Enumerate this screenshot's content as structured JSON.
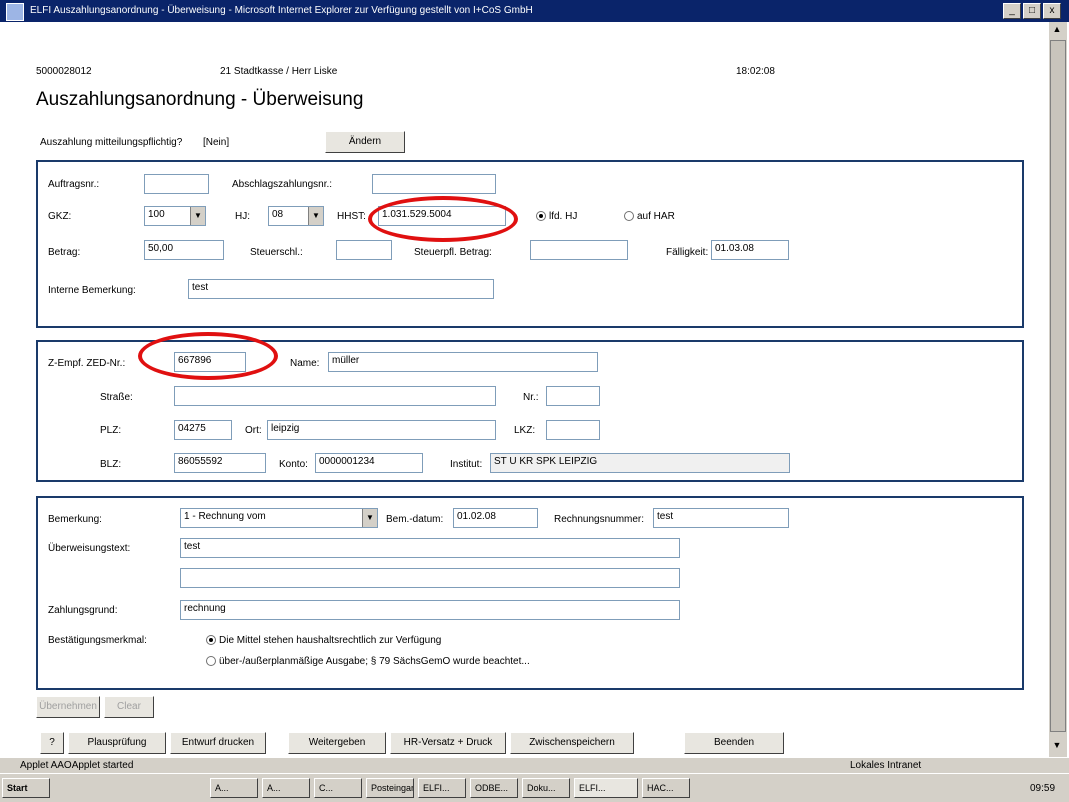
{
  "window": {
    "title": "ELFI Auszahlungsanordnung - Überweisung - Microsoft Internet Explorer zur Verfügung gestellt von I+CoS GmbH",
    "min": "_",
    "max": "□",
    "close": "x"
  },
  "header": {
    "id": "5000028012",
    "office": "21 Stadtkasse / Herr Liske",
    "time": "18:02:08",
    "title": "Auszahlungsanordnung - Überweisung"
  },
  "mitteilung": {
    "question": "Auszahlung mitteilungspflichtig?",
    "value": "[Nein]",
    "change_button": "Ändern"
  },
  "section1": {
    "auftragsnr_label": "Auftragsnr.:",
    "auftragsnr_value": "",
    "abschlag_label": "Abschlagszahlungsnr.:",
    "abschlag_value": "",
    "gkz_label": "GKZ:",
    "gkz_value": "100",
    "hj_label": "HJ:",
    "hj_value": "08",
    "hhst_label": "HHST:",
    "hhst_value": "1.031.529.5004",
    "radio_lfd": "lfd. HJ",
    "radio_har": "auf HAR",
    "betrag_label": "Betrag:",
    "betrag_value": "50,00",
    "steuerschl_label": "Steuerschl.:",
    "steuerschl_value": "",
    "steuerpfl_label": "Steuerpfl. Betrag:",
    "steuerpfl_value": "",
    "faelligkeit_label": "Fälligkeit:",
    "faelligkeit_value": "01.03.08",
    "interne_label": "Interne Bemerkung:",
    "interne_value": "test"
  },
  "section2": {
    "zed_label": "Z-Empf. ZED-Nr.:",
    "zed_value": "667896",
    "name_label": "Name:",
    "name_value": "müller",
    "strasse_label": "Straße:",
    "strasse_value": "",
    "nr_label": "Nr.:",
    "nr_value": "",
    "plz_label": "PLZ:",
    "plz_value": "04275",
    "ort_label": "Ort:",
    "ort_value": "leipzig",
    "lkz_label": "LKZ:",
    "lkz_value": "",
    "blz_label": "BLZ:",
    "blz_value": "86055592",
    "konto_label": "Konto:",
    "konto_value": "0000001234",
    "institut_label": "Institut:",
    "institut_value": "ST U KR SPK LEIPZIG"
  },
  "section3": {
    "bemerkung_label": "Bemerkung:",
    "bemerkung_value": "1 - Rechnung vom",
    "bemdatum_label": "Bem.-datum:",
    "bemdatum_value": "01.02.08",
    "rechnr_label": "Rechnungsnummer:",
    "rechnr_value": "test",
    "ueberweisung_label": "Überweisungstext:",
    "ueberweisung_value1": "test",
    "ueberweisung_value2": "",
    "zahlungsgrund_label": "Zahlungsgrund:",
    "zahlungsgrund_value": "rechnung",
    "bestaetigung_label": "Bestätigungsmerkmal:",
    "option1": "Die Mittel stehen haushaltsrechtlich zur Verfügung",
    "option2": "über-/außerplanmäßige Ausgabe; § 79 SächsGemO wurde beachtet..."
  },
  "disabled_buttons": {
    "b1": "Übernehmen",
    "b2": "Clear"
  },
  "bottom_buttons": {
    "help": "?",
    "plaus": "Plausprüfung",
    "entwurf": "Entwurf drucken",
    "weiter": "Weitergeben",
    "hr": "HR-Versatz + Druck",
    "zwischen": "Zwischenspeichern",
    "beenden": "Beenden"
  },
  "status": {
    "left": "Applet AAOApplet started",
    "zone": "Lokales Intranet"
  },
  "taskbar": {
    "start": "Start",
    "items": [
      "A...",
      "A...",
      "C...",
      "Posteingang...",
      "ELFI...",
      "ODBE...",
      "Doku...",
      "ELFI...",
      "HAC..."
    ],
    "clock": "09:59"
  },
  "colors": {
    "frame": "#1a3a6a",
    "highlight": "#e01010",
    "titlebar": "#0a246a"
  }
}
